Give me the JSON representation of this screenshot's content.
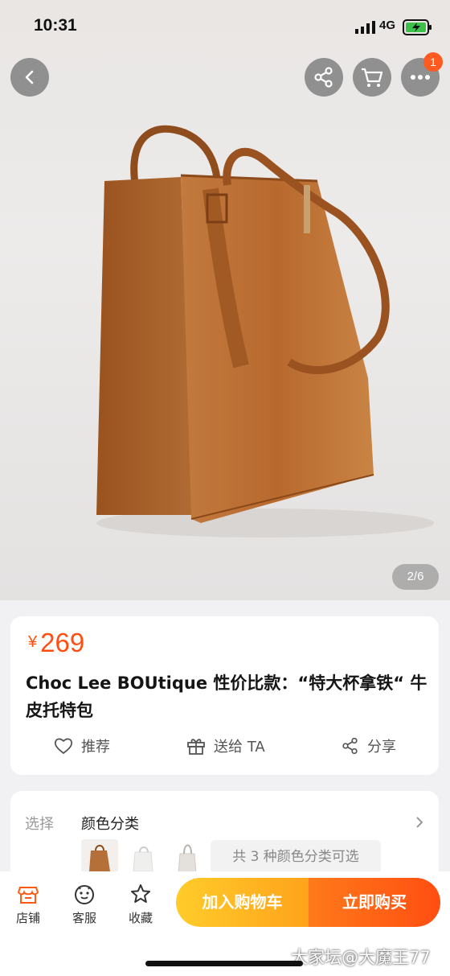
{
  "status_bar": {
    "time": "10:31",
    "network": "4G"
  },
  "top_actions": {
    "cart_badge": "1"
  },
  "gallery": {
    "indicator": "2/6"
  },
  "product": {
    "currency": "¥",
    "price": "269",
    "title": "Choc Lee BOUtique 性价比款：“特大杯拿铁“ 牛皮托特包"
  },
  "actions": {
    "recommend": "推荐",
    "gift": "送给 TA",
    "share": "分享"
  },
  "select": {
    "label": "选择",
    "value": "颜色分类",
    "count_text": "共 3 种颜色分类可选"
  },
  "bottom_bar": {
    "shop": "店铺",
    "service": "客服",
    "favorite": "收藏",
    "add_to_cart": "加入购物车",
    "buy_now": "立即购买"
  },
  "watermark": "大家坛@大魔王77",
  "colors": {
    "accent": "#ff4e11",
    "cart_button": "#ffb020",
    "buy_button": "#ff5a14",
    "brown": "#b5703a"
  },
  "icons": [
    "back-icon",
    "share-icon",
    "cart-icon",
    "more-icon",
    "heart-icon",
    "gift-icon",
    "share-icon",
    "chevron-right-icon",
    "shop-icon",
    "service-icon",
    "star-icon"
  ]
}
